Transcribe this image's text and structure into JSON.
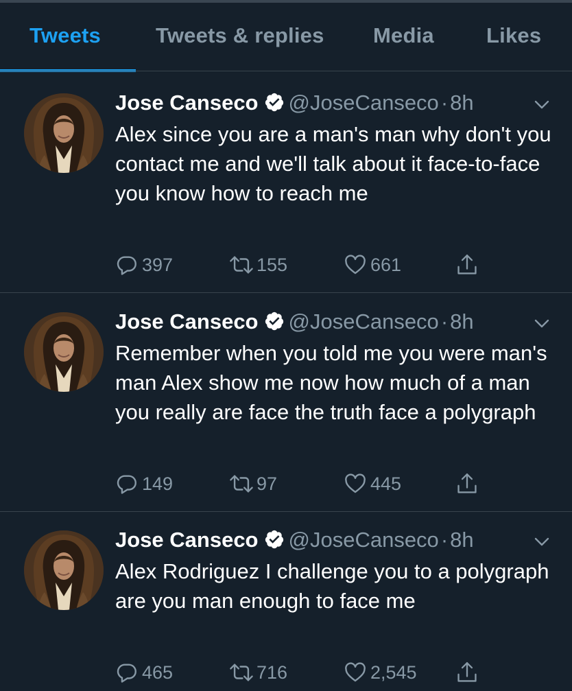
{
  "tabs": [
    {
      "label": "Tweets",
      "active": true
    },
    {
      "label": "Tweets & replies",
      "active": false
    },
    {
      "label": "Media",
      "active": false
    },
    {
      "label": "Likes",
      "active": false
    }
  ],
  "colors": {
    "background": "#15202b",
    "accent": "#1da1f2",
    "muted": "#8899a6",
    "divider": "#38444d"
  },
  "tweets": [
    {
      "name": "Jose Canseco",
      "handle": "@JoseCanseco",
      "separator": "·",
      "time": "8h",
      "text": "Alex since you are a man's man why don't you contact me and we'll talk about it face-to-face you know how to reach me",
      "replies": "397",
      "retweets": "155",
      "likes": "661"
    },
    {
      "name": "Jose Canseco",
      "handle": "@JoseCanseco",
      "separator": "·",
      "time": "8h",
      "text": "Remember when you told me you were man's man Alex show me now how much of a man you really are face the truth face a polygraph",
      "replies": "149",
      "retweets": "97",
      "likes": "445"
    },
    {
      "name": "Jose Canseco",
      "handle": "@JoseCanseco",
      "separator": "·",
      "time": "8h",
      "text": "Alex Rodriguez I challenge you to a polygraph are you man enough to face me",
      "replies": "465",
      "retweets": "716",
      "likes": "2,545"
    }
  ],
  "icons": {
    "verified": "verified-badge-icon",
    "menu": "chevron-down-icon",
    "reply": "reply-icon",
    "retweet": "retweet-icon",
    "like": "heart-icon",
    "share": "share-icon"
  }
}
